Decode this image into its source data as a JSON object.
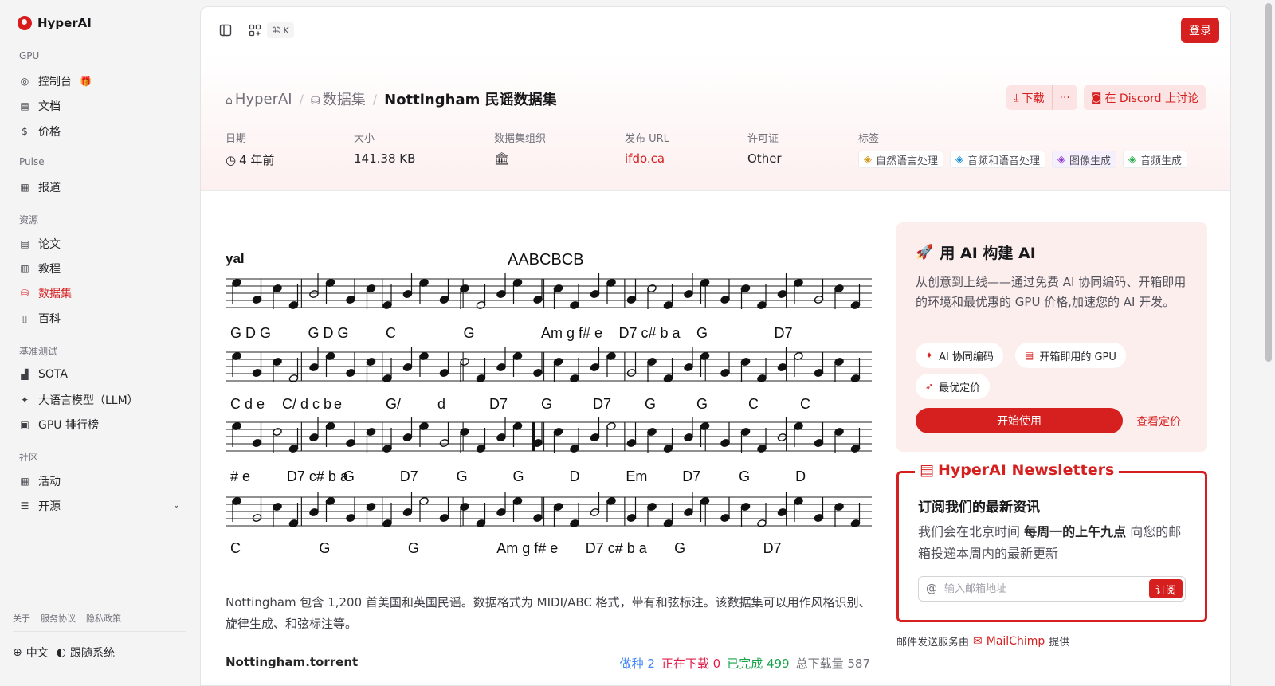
{
  "app": {
    "name": "HyperAI"
  },
  "sidebar": {
    "sections": [
      {
        "title": "GPU",
        "items": [
          {
            "label": "控制台",
            "icon": "gauge-icon"
          },
          {
            "label": "文档",
            "icon": "doc-icon"
          },
          {
            "label": "价格",
            "icon": "coin-icon"
          }
        ]
      },
      {
        "title": "Pulse",
        "items": [
          {
            "label": "报道",
            "icon": "news-icon"
          }
        ]
      },
      {
        "title": "资源",
        "items": [
          {
            "label": "论文",
            "icon": "paper-icon"
          },
          {
            "label": "教程",
            "icon": "book-icon"
          },
          {
            "label": "数据集",
            "icon": "database-icon",
            "active": true
          },
          {
            "label": "百科",
            "icon": "wiki-icon"
          }
        ]
      },
      {
        "title": "基准测试",
        "items": [
          {
            "label": "SOTA",
            "icon": "chart-icon"
          },
          {
            "label": "大语言模型（LLM）",
            "icon": "sparkle-icon"
          },
          {
            "label": "GPU 排行榜",
            "icon": "chip-icon"
          }
        ]
      },
      {
        "title": "社区",
        "items": [
          {
            "label": "活动",
            "icon": "calendar-icon"
          },
          {
            "label": "开源",
            "icon": "list-icon"
          }
        ]
      }
    ],
    "footer_links": [
      "关于",
      "服务协议",
      "隐私政策"
    ],
    "language": "中文",
    "theme": "跟随系统"
  },
  "topbar": {
    "shortcut": "⌘ K",
    "login": "登录"
  },
  "breadcrumb": {
    "home": "HyperAI",
    "section": "数据集",
    "current": "Nottingham 民谣数据集"
  },
  "actions": {
    "download": "下载",
    "more": "···",
    "discord": "在 Discord 上讨论"
  },
  "meta": {
    "date_label": "日期",
    "date": "4 年前",
    "size_label": "大小",
    "size": "141.38 KB",
    "org_label": "数据集组织",
    "url_label": "发布 URL",
    "url": "ifdo.ca",
    "license_label": "许可证",
    "license": "Other",
    "tags_label": "标签",
    "tags": [
      {
        "label": "自然语言处理",
        "color": "#d19a1a"
      },
      {
        "label": "音频和语音处理",
        "color": "#1a8fd1"
      },
      {
        "label": "图像生成",
        "color": "#8b3fd1"
      },
      {
        "label": "音频生成",
        "color": "#2aa84a"
      }
    ]
  },
  "score": {
    "left_label": "yal",
    "title": "AABCBCB",
    "row1": [
      "G D G",
      "G D G",
      "C",
      "G",
      "Am g f# e",
      "D7 c# b a",
      "G",
      "D7"
    ],
    "row2": [
      "C d e",
      "C/ d c b",
      "e",
      "G/",
      "d",
      "D7",
      "G",
      "D7",
      "G",
      "G",
      "C",
      "C"
    ],
    "row3": [
      "# e",
      "D7 c# b a",
      "G",
      "D7",
      "G",
      "G",
      "D",
      "Em",
      "D7",
      "G",
      "D"
    ],
    "row4": [
      "C",
      "G",
      "G",
      "Am g f# e",
      "D7 c# b a",
      "G",
      "D7"
    ]
  },
  "description": "Nottingham 包含 1,200 首美国和英国民谣。数据格式为 MIDI/ABC 格式，带有和弦标注。该数据集可以用作风格识别、旋律生成、和弦标注等。",
  "torrent": {
    "name": "Nottingham.torrent",
    "seeding": "做种 2",
    "downloading": "正在下载 0",
    "completed": "已完成 499",
    "total": "总下载量 587"
  },
  "promo": {
    "title": "用 AI 构建 AI",
    "text": "从创意到上线——通过免费 AI 协同编码、开箱即用的环境和最优惠的 GPU 价格,加速您的 AI 开发。",
    "chips": [
      "AI 协同编码",
      "开箱即用的 GPU",
      "最优定价"
    ],
    "start": "开始使用",
    "pricing": "查看定价"
  },
  "newsletter": {
    "title": "HyperAI Newsletters",
    "heading": "订阅我们的最新资讯",
    "text_a": "我们会在北京时间 ",
    "text_b": "每周一的上午九点",
    "text_c": " 向您的邮箱投递本周内的最新更新",
    "placeholder": "输入邮箱地址",
    "subscribe": "订阅",
    "provider_prefix": "邮件发送服务由",
    "provider": "MailChimp",
    "provider_suffix": "提供"
  },
  "colors": {
    "accent": "#d61f1f",
    "seeding": "#3b82f6",
    "downloading": "#e11d48",
    "completed": "#16a34a",
    "total": "#71717a"
  }
}
